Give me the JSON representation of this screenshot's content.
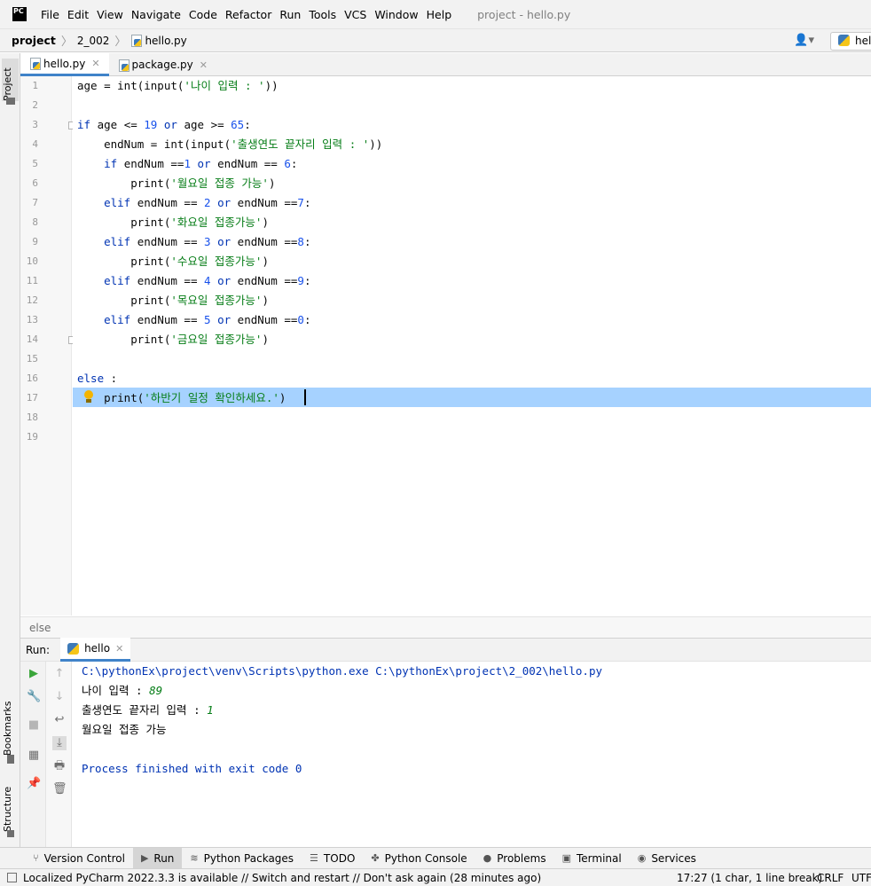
{
  "menubar": {
    "logo_text": "PC",
    "items": [
      "File",
      "Edit",
      "View",
      "Navigate",
      "Code",
      "Refactor",
      "Run",
      "Tools",
      "VCS",
      "Window",
      "Help"
    ],
    "window_title": "project - hello.py"
  },
  "navbar": {
    "project": "project",
    "folder": "2_002",
    "file": "hello.py",
    "run_config": "hel"
  },
  "left_strip": {
    "project": "Project",
    "bookmarks": "Bookmarks",
    "structure": "Structure"
  },
  "editor_tabs": [
    {
      "label": "hello.py",
      "active": true
    },
    {
      "label": "package.py",
      "active": false
    }
  ],
  "editor": {
    "line_numbers": [
      "1",
      "2",
      "3",
      "4",
      "5",
      "6",
      "7",
      "8",
      "9",
      "10",
      "11",
      "12",
      "13",
      "14",
      "15",
      "16",
      "17",
      "18",
      "19"
    ],
    "code_breadcrumb": "else"
  },
  "run_panel": {
    "label": "Run:",
    "tab": "hello",
    "output": {
      "command": "C:\\pythonEx\\project\\venv\\Scripts\\python.exe C:\\pythonEx\\project\\2_002\\hello.py",
      "prompt1": "나이 입력 : ",
      "input1": "89",
      "prompt2": "출생연도 끝자리 입력 : ",
      "input2": "1",
      "result": "월요일 접종 가능",
      "exit": "Process finished with exit code 0"
    }
  },
  "bottom_tabs": [
    {
      "label": "Version Control",
      "icon": "branch-icon"
    },
    {
      "label": "Run",
      "icon": "play-icon"
    },
    {
      "label": "Python Packages",
      "icon": "layers-icon"
    },
    {
      "label": "TODO",
      "icon": "list-icon"
    },
    {
      "label": "Python Console",
      "icon": "python-icon"
    },
    {
      "label": "Problems",
      "icon": "warning-icon"
    },
    {
      "label": "Terminal",
      "icon": "terminal-icon"
    },
    {
      "label": "Services",
      "icon": "services-icon"
    }
  ],
  "statusbar": {
    "message": "Localized PyCharm 2022.3.3 is available // Switch and restart // Don't ask again (28 minutes ago)",
    "position": "17:27 (1 char, 1 line break)",
    "line_sep": "CRLF",
    "encoding": "UTF-"
  }
}
